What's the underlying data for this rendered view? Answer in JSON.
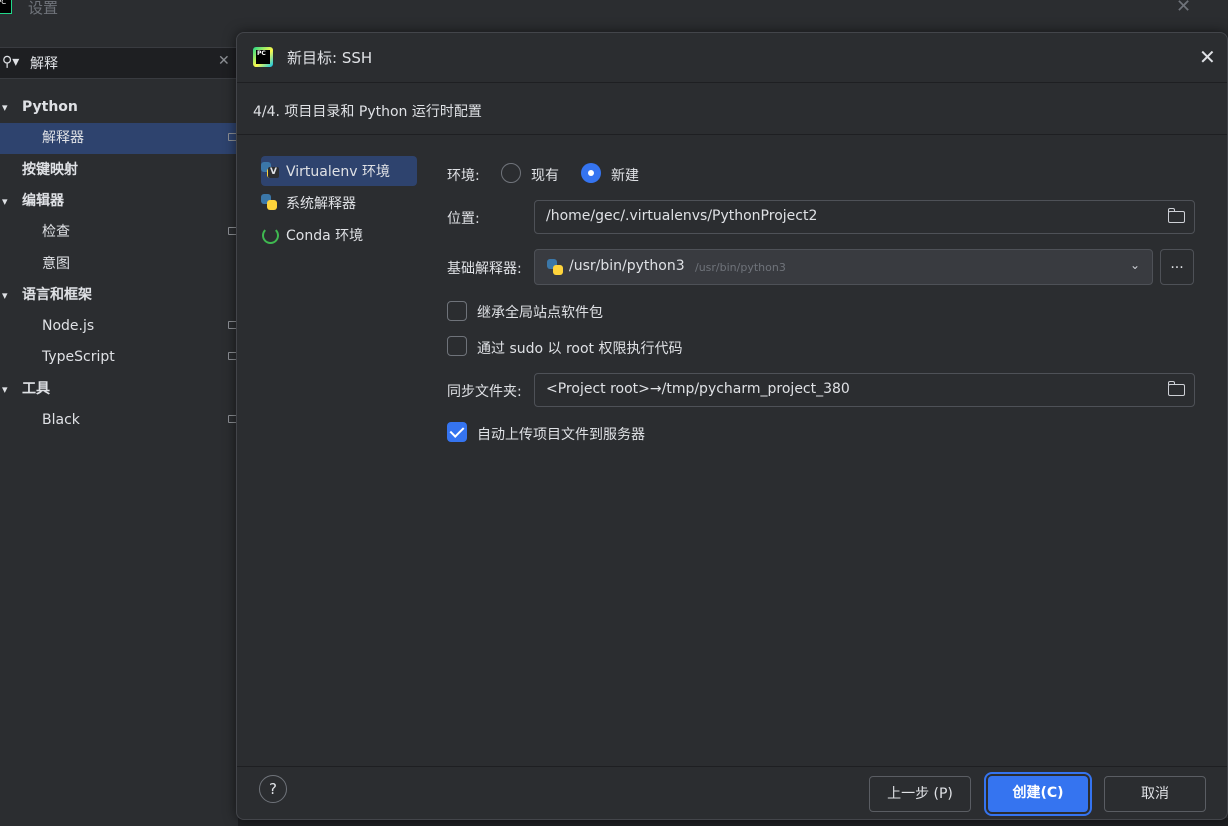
{
  "window": {
    "title": "设置",
    "app_icon_text": "PC"
  },
  "search": {
    "value": "解释"
  },
  "tree": [
    {
      "label": "Python",
      "bold": true
    },
    {
      "label": "解释器",
      "selected": true
    },
    {
      "label": "按键映射",
      "bold": true
    },
    {
      "label": "编辑器",
      "bold": true
    },
    {
      "label": "检查"
    },
    {
      "label": "意图"
    },
    {
      "label": "语言和框架",
      "bold": true
    },
    {
      "label": "Node.js"
    },
    {
      "label": "TypeScript"
    },
    {
      "label": "工具",
      "bold": true
    },
    {
      "label": "Black"
    }
  ],
  "dialog": {
    "title": "新目标: SSH",
    "logo_text": "PC",
    "step_title": "4/4. 项目目录和 Python 运行时配置",
    "env_types": [
      {
        "label": "Virtualenv 环境",
        "icon": "virtualenv-icon",
        "selected": true
      },
      {
        "label": "系统解释器",
        "icon": "python-icon"
      },
      {
        "label": "Conda 环境",
        "icon": "conda-icon"
      }
    ],
    "form": {
      "env_label": "环境:",
      "radio_existing": "现有",
      "radio_new": "新建",
      "radio_selected": "新建",
      "location_label": "位置:",
      "location_value": "/home/gec/.virtualenvs/PythonProject2",
      "base_interp_label": "基础解释器:",
      "base_interp_value": "/usr/bin/python3",
      "base_interp_hint": "/usr/bin/python3",
      "browse_label": "...",
      "inherit_label": "继承全局站点软件包",
      "inherit_checked": false,
      "sudo_label": "通过 sudo 以 root 权限执行代码",
      "sudo_checked": false,
      "sync_label": "同步文件夹:",
      "sync_value": "<Project root>→/tmp/pycharm_project_380",
      "autoupload_label": "自动上传项目文件到服务器",
      "autoupload_checked": true
    },
    "buttons": {
      "help": "?",
      "prev": "上一步 (P)",
      "create": "创建(C)",
      "cancel": "取消"
    }
  },
  "colors": {
    "accent": "#3574f0",
    "selection": "#2e436e",
    "background": "#2b2d30"
  }
}
